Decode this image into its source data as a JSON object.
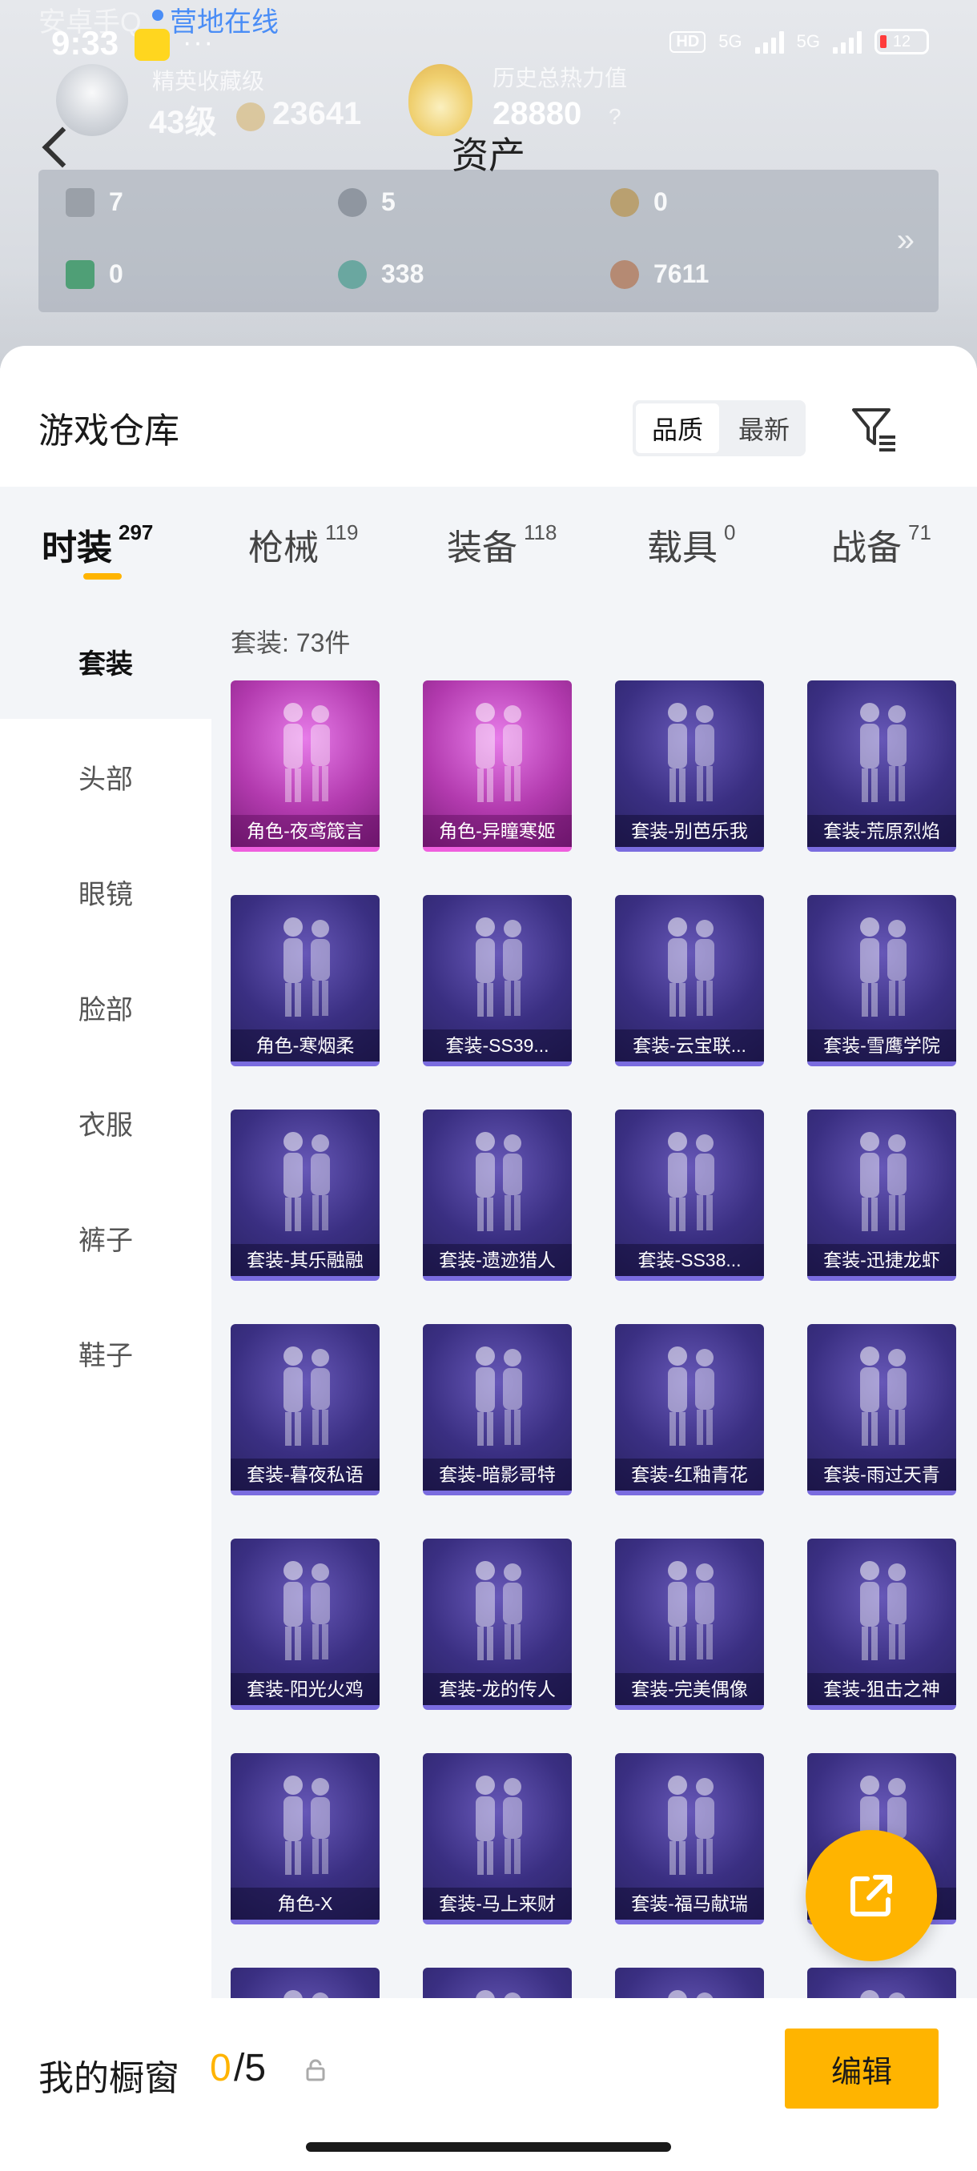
{
  "status_bar": {
    "time": "9:33",
    "overlay_label": "安卓手Q",
    "online_text": "营地在线",
    "more_dots": "···",
    "hd": "HD",
    "net1": "5G",
    "net2": "5G",
    "battery": "12"
  },
  "hero": {
    "stat_a_label": "精英收藏级",
    "stat_a_level": "43级",
    "stat_a_points": "23641",
    "stat_b_label": "历史总热力值",
    "stat_b_value": "28880",
    "help": "?"
  },
  "page_title": "资产",
  "assets": [
    {
      "value": "7",
      "icon": "card-icon",
      "color": "#9aa0a8"
    },
    {
      "value": "5",
      "icon": "silver-coin-icon",
      "color": "#8f96a0"
    },
    {
      "value": "0",
      "icon": "gold-coin-icon",
      "color": "#b9a070"
    },
    {
      "value": "0",
      "icon": "green-card-icon",
      "color": "#4f9f76"
    },
    {
      "value": "338",
      "icon": "gem-icon",
      "color": "#6aa7a0"
    },
    {
      "value": "7611",
      "icon": "bronze-coin-icon",
      "color": "#b58a73"
    }
  ],
  "asset_more": "»",
  "warehouse": {
    "title": "游戏仓库",
    "sort_options": [
      "品质",
      "最新"
    ],
    "sort_active": 0
  },
  "tabs": [
    {
      "label": "时装",
      "count": "297",
      "active": true
    },
    {
      "label": "枪械",
      "count": "119"
    },
    {
      "label": "装备",
      "count": "118"
    },
    {
      "label": "载具",
      "count": "0"
    },
    {
      "label": "战备",
      "count": "71"
    }
  ],
  "side_nav": [
    "套装",
    "头部",
    "眼镜",
    "脸部",
    "衣服",
    "裤子",
    "鞋子"
  ],
  "grid_count": "套装: 73件",
  "items": [
    {
      "label": "角色-夜鸢箴言",
      "rarity": "pink"
    },
    {
      "label": "角色-异瞳寒姬",
      "rarity": "pink"
    },
    {
      "label": "套装-别芭乐我",
      "rarity": "purple"
    },
    {
      "label": "套装-荒原烈焰",
      "rarity": "purple"
    },
    {
      "label": "角色-寒烟柔",
      "rarity": "purple"
    },
    {
      "label": "套装-SS39...",
      "rarity": "purple"
    },
    {
      "label": "套装-云宝联...",
      "rarity": "purple"
    },
    {
      "label": "套装-雪鹰学院",
      "rarity": "purple"
    },
    {
      "label": "套装-其乐融融",
      "rarity": "purple"
    },
    {
      "label": "套装-遗迹猎人",
      "rarity": "purple"
    },
    {
      "label": "套装-SS38...",
      "rarity": "purple"
    },
    {
      "label": "套装-迅捷龙虾",
      "rarity": "purple"
    },
    {
      "label": "套装-暮夜私语",
      "rarity": "purple"
    },
    {
      "label": "套装-暗影哥特",
      "rarity": "purple"
    },
    {
      "label": "套装-红釉青花",
      "rarity": "purple"
    },
    {
      "label": "套装-雨过天青",
      "rarity": "purple"
    },
    {
      "label": "套装-阳光火鸡",
      "rarity": "purple"
    },
    {
      "label": "套装-龙的传人",
      "rarity": "purple"
    },
    {
      "label": "套装-完美偶像",
      "rarity": "purple"
    },
    {
      "label": "套装-狙击之神",
      "rarity": "purple"
    },
    {
      "label": "角色-X",
      "rarity": "purple"
    },
    {
      "label": "套装-马上来财",
      "rarity": "purple"
    },
    {
      "label": "套装-福马献瑞",
      "rarity": "purple"
    },
    {
      "label": "...",
      "rarity": "purple"
    },
    {
      "label": "",
      "rarity": "purple"
    },
    {
      "label": "",
      "rarity": "purple"
    },
    {
      "label": "",
      "rarity": "purple"
    },
    {
      "label": "",
      "rarity": "purple"
    }
  ],
  "showcase": {
    "label": "我的橱窗",
    "current": "0",
    "max": "/5"
  },
  "edit_button": "编辑",
  "colors": {
    "accent": "#ffb400",
    "card_purple": "#3a2f82",
    "card_pink": "#b23aae"
  }
}
